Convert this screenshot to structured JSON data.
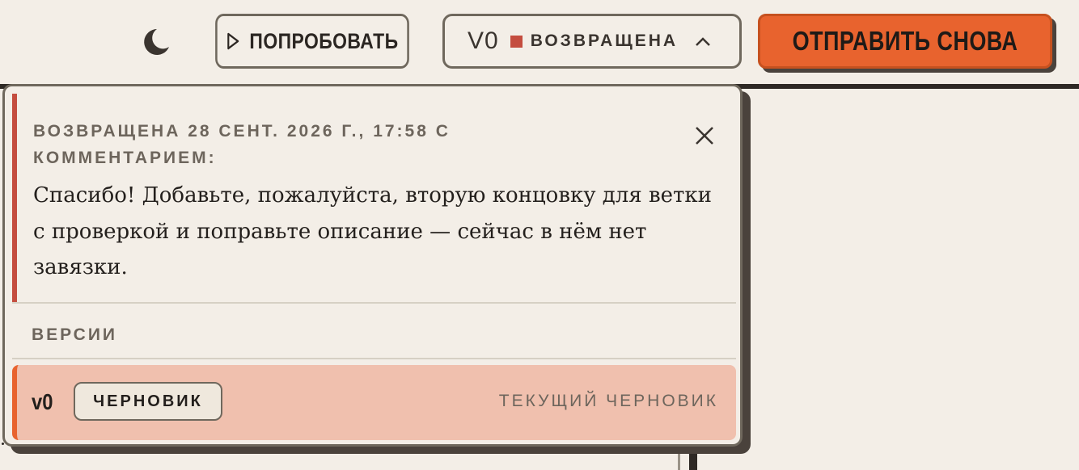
{
  "toolbar": {
    "theme_icon": "moon-icon",
    "try_label": "ПОПРОБОВАТЬ",
    "try_icon": "play-icon",
    "version_select": {
      "code": "V0",
      "status": "ВОЗВРАЩЕНА",
      "status_color": "#c44d3f",
      "icon": "chevron-up-icon"
    },
    "resend_label": "ОТПРАВИТЬ СНОВА",
    "accent": "#e8632e"
  },
  "popover": {
    "comment": {
      "header": "ВОЗВРАЩЕНА 28 СЕНТ. 2026 Г., 17:58 С КОММЕНТАРИЕМ:",
      "text": "Спасибо! Добавьте, пожалуйста, вторую концовку для ветки с проверкой и поправьте описание — сейчас в нём нет завязки.",
      "close_icon": "close-icon"
    },
    "versions_label": "ВЕРСИИ",
    "versions": [
      {
        "version": "v0",
        "badge": "ЧЕРНОВИК",
        "note": "ТЕКУЩИЙ ЧЕРНОВИК"
      }
    ]
  }
}
